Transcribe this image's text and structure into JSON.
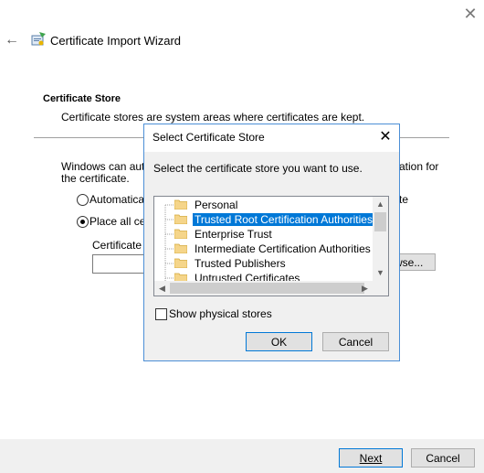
{
  "wizard": {
    "title": "Certificate Import Wizard",
    "section_heading": "Certificate Store",
    "section_description": "Certificate stores are system areas where certificates are kept.",
    "windows_text_line1": "Windows can autor",
    "windows_text_line1_right": "ation for",
    "windows_text_line2": "the certificate.",
    "radio_auto_label": "Automaticall",
    "radio_auto_label_right": "te",
    "radio_place_label": "Place all cer",
    "radio_selected": "place",
    "cert_store_label": "Certificate s",
    "cert_store_value": "",
    "browse_label": "wse...",
    "next_label": "Next",
    "cancel_label": "Cancel"
  },
  "dialog": {
    "title": "Select Certificate Store",
    "instruction": "Select the certificate store you want to use.",
    "stores": [
      {
        "label": "Personal",
        "selected": false
      },
      {
        "label": "Trusted Root Certification Authorities",
        "selected": true
      },
      {
        "label": "Enterprise Trust",
        "selected": false
      },
      {
        "label": "Intermediate Certification Authorities",
        "selected": false
      },
      {
        "label": "Trusted Publishers",
        "selected": false
      },
      {
        "label": "Untrusted Certificates",
        "selected": false
      }
    ],
    "show_physical_label": "Show physical stores",
    "show_physical_checked": false,
    "ok_label": "OK",
    "cancel_label": "Cancel"
  },
  "icons": {
    "window_close": "close-icon",
    "back": "back-arrow-icon",
    "wizard": "certificate-wizard-icon",
    "folder": "folder-icon"
  },
  "colors": {
    "accent": "#0078d7",
    "selection": "#0078d7",
    "folder": "#f5d58a"
  }
}
